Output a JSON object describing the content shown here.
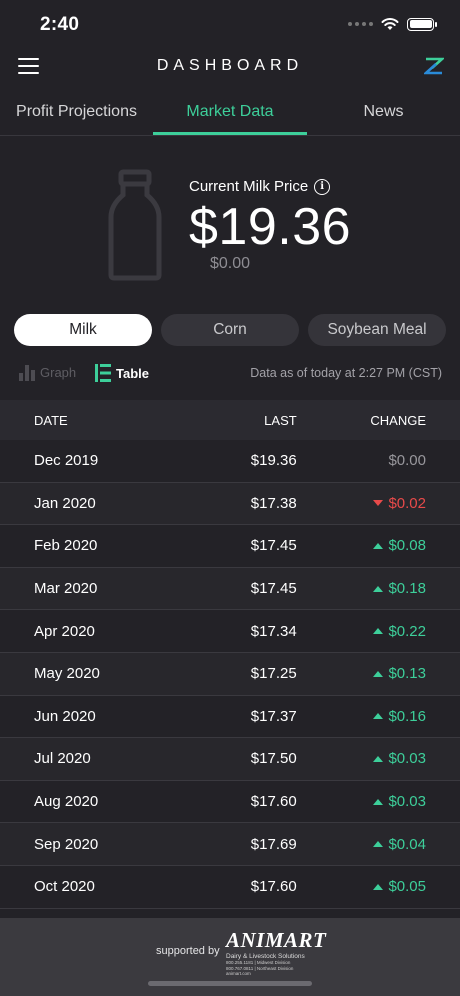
{
  "status_bar": {
    "time": "2:40"
  },
  "header": {
    "title": "DASHBOARD"
  },
  "tabs": [
    {
      "label": "Profit Projections",
      "active": false
    },
    {
      "label": "Market Data",
      "active": true
    },
    {
      "label": "News",
      "active": false
    }
  ],
  "price": {
    "label": "Current Milk Price",
    "value": "$19.36",
    "change": "$0.00"
  },
  "commodities": [
    {
      "label": "Milk",
      "active": true
    },
    {
      "label": "Corn",
      "active": false
    },
    {
      "label": "Soybean Meal",
      "active": false
    }
  ],
  "view": {
    "graph_label": "Graph",
    "table_label": "Table",
    "active": "Table",
    "as_of": "Data as of today at 2:27 PM (CST)"
  },
  "table": {
    "headers": {
      "date": "DATE",
      "last": "LAST",
      "change": "CHANGE"
    },
    "rows": [
      {
        "date": "Dec 2019",
        "last": "$19.36",
        "change": "$0.00",
        "direction": "flat"
      },
      {
        "date": "Jan 2020",
        "last": "$17.38",
        "change": "$0.02",
        "direction": "down"
      },
      {
        "date": "Feb 2020",
        "last": "$17.45",
        "change": "$0.08",
        "direction": "up"
      },
      {
        "date": "Mar 2020",
        "last": "$17.45",
        "change": "$0.18",
        "direction": "up"
      },
      {
        "date": "Apr 2020",
        "last": "$17.34",
        "change": "$0.22",
        "direction": "up"
      },
      {
        "date": "May 2020",
        "last": "$17.25",
        "change": "$0.13",
        "direction": "up"
      },
      {
        "date": "Jun 2020",
        "last": "$17.37",
        "change": "$0.16",
        "direction": "up"
      },
      {
        "date": "Jul 2020",
        "last": "$17.50",
        "change": "$0.03",
        "direction": "up"
      },
      {
        "date": "Aug 2020",
        "last": "$17.60",
        "change": "$0.03",
        "direction": "up"
      },
      {
        "date": "Sep 2020",
        "last": "$17.69",
        "change": "$0.04",
        "direction": "up"
      },
      {
        "date": "Oct 2020",
        "last": "$17.60",
        "change": "$0.05",
        "direction": "up"
      }
    ]
  },
  "footer": {
    "supported_by": "supported by",
    "sponsor_name": "ANIMART",
    "sponsor_tagline": "Dairy & Livestock Solutions",
    "sponsor_line1": "800.255.1181 | Midwest Division",
    "sponsor_line2": "800.767.0811 | Northeast Division",
    "sponsor_line3": "animart.com"
  },
  "colors": {
    "background": "#232227",
    "accent": "#3dcf9a",
    "negative": "#e84a4a",
    "muted": "#98979c"
  },
  "icons": {
    "menu": "menu-icon",
    "logo": "z-logo-icon",
    "bottle": "milk-bottle-icon",
    "info": "info-icon",
    "graph": "bar-graph-icon",
    "table": "table-icon",
    "wifi": "wifi-icon",
    "battery": "battery-icon"
  }
}
